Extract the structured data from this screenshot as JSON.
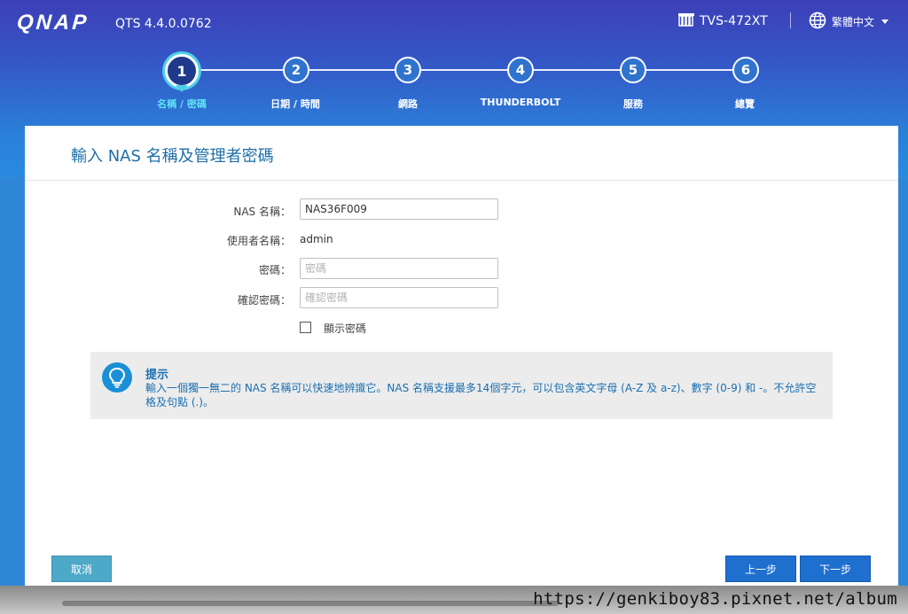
{
  "header": {
    "logo": "QNAP",
    "version": "QTS 4.4.0.0762",
    "model": "TVS-472XT",
    "language": "繁體中文"
  },
  "steps": [
    {
      "number": "1",
      "label": "名稱 / 密碼",
      "active": true
    },
    {
      "number": "2",
      "label": "日期 / 時間",
      "active": false
    },
    {
      "number": "3",
      "label": "網路",
      "active": false
    },
    {
      "number": "4",
      "label": "THUNDERBOLT",
      "active": false
    },
    {
      "number": "5",
      "label": "服務",
      "active": false
    },
    {
      "number": "6",
      "label": "總覽",
      "active": false
    }
  ],
  "form": {
    "title": "輸入 NAS 名稱及管理者密碼",
    "nas_name_label": "NAS 名稱：",
    "nas_name_value": "NAS36F009",
    "username_label": "使用者名稱：",
    "username_value": "admin",
    "password_label": "密碼：",
    "password_placeholder": "密碼",
    "confirm_label": "確認密碼：",
    "confirm_placeholder": "確認密碼",
    "show_password_label": "顯示密碼"
  },
  "tip": {
    "title": "提示",
    "text": "輸入一個獨一無二的 NAS 名稱可以快速地辨識它。NAS 名稱支援最多14個字元，可以包含英文字母 (A-Z 及 a-z)、數字 (0-9) 和 -。不允許空格及句點 (.)。"
  },
  "buttons": {
    "cancel": "取消",
    "prev": "上一步",
    "next": "下一步"
  },
  "watermark": "https://genkiboy83.pixnet.net/album",
  "colors": {
    "accent": "#1f6fcf",
    "active_step": "#4fd0e8",
    "title_blue": "#1e6fa8"
  }
}
